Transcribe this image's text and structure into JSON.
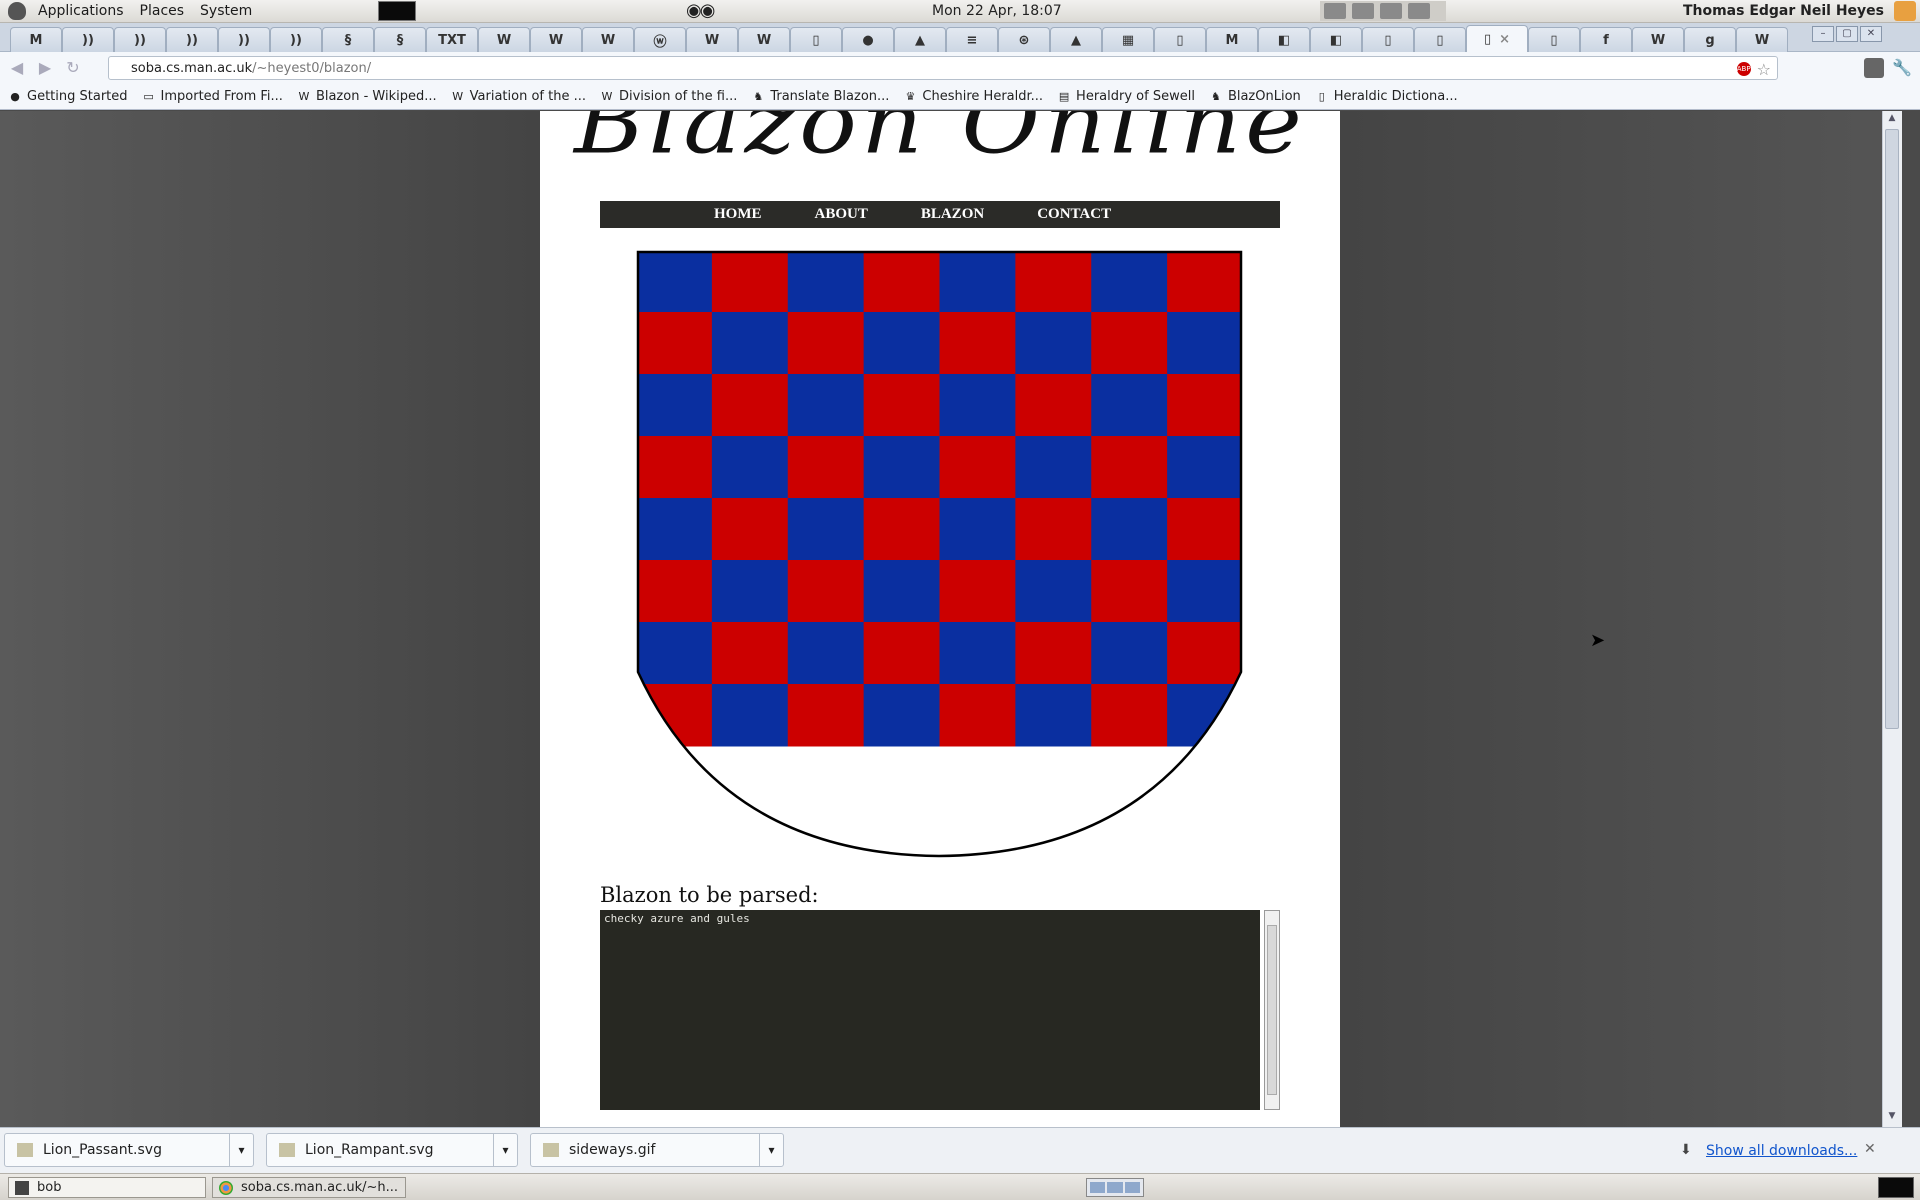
{
  "panel": {
    "menus": [
      "Applications",
      "Places",
      "System"
    ],
    "clock": "Mon 22 Apr, 18:07",
    "user": "Thomas Edgar Neil Heyes"
  },
  "tabs": [
    {
      "icon": "gmail-icon",
      "glyph": "M"
    },
    {
      "icon": "blazon-favicon",
      "glyph": "))"
    },
    {
      "icon": "blazon-favicon",
      "glyph": "))"
    },
    {
      "icon": "blazon-favicon",
      "glyph": "))"
    },
    {
      "icon": "blazon-favicon",
      "glyph": "))"
    },
    {
      "icon": "blazon-favicon",
      "glyph": "))"
    },
    {
      "icon": "heraldry-favicon",
      "glyph": "§"
    },
    {
      "icon": "heraldry-favicon",
      "glyph": "§"
    },
    {
      "icon": "document-icon",
      "glyph": "TXT"
    },
    {
      "icon": "wikipedia-icon",
      "glyph": "W"
    },
    {
      "icon": "wikipedia-icon",
      "glyph": "W"
    },
    {
      "icon": "wikipedia-icon",
      "glyph": "W"
    },
    {
      "icon": "wordpress-icon",
      "glyph": "ⓦ"
    },
    {
      "icon": "wikipedia-icon",
      "glyph": "W"
    },
    {
      "icon": "wikipedia-icon",
      "glyph": "W"
    },
    {
      "icon": "blank-page-icon",
      "glyph": "▯"
    },
    {
      "icon": "github-icon",
      "glyph": "●"
    },
    {
      "icon": "google-drive-icon",
      "glyph": "▲"
    },
    {
      "icon": "google-docs-icon",
      "glyph": "≡"
    },
    {
      "icon": "settings-icon",
      "glyph": "⊛"
    },
    {
      "icon": "google-drive-icon",
      "glyph": "▲"
    },
    {
      "icon": "google-sheets-icon",
      "glyph": "▦"
    },
    {
      "icon": "blank-page-icon",
      "glyph": "▯"
    },
    {
      "icon": "m-icon",
      "glyph": "M"
    },
    {
      "icon": "shield-icon",
      "glyph": "◧"
    },
    {
      "icon": "shield-icon",
      "glyph": "◧"
    },
    {
      "icon": "blank-page-icon",
      "glyph": "▯"
    },
    {
      "icon": "blank-page-icon",
      "glyph": "▯"
    },
    {
      "icon": "blank-page-icon",
      "glyph": "▯",
      "active": true
    },
    {
      "icon": "blank-page-icon",
      "glyph": "▯"
    },
    {
      "icon": "facebook-icon",
      "glyph": "f"
    },
    {
      "icon": "wikipedia-icon",
      "glyph": "W"
    },
    {
      "icon": "google-icon",
      "glyph": "g"
    },
    {
      "icon": "wikipedia-icon",
      "glyph": "W"
    }
  ],
  "toolbar": {
    "url_host": "soba.cs.man.ac.uk",
    "url_path": "/~heyest0/blazon/"
  },
  "bookmarks": [
    {
      "label": "Getting Started",
      "icon": "firefox-icon"
    },
    {
      "label": "Imported From Fi...",
      "icon": "folder-icon"
    },
    {
      "label": "Blazon - Wikiped...",
      "icon": "wikipedia-icon"
    },
    {
      "label": "Variation of the ...",
      "icon": "wikipedia-icon"
    },
    {
      "label": "Division of the fi...",
      "icon": "wikipedia-icon"
    },
    {
      "label": "Translate Blazon...",
      "icon": "lion-icon"
    },
    {
      "label": "Cheshire Heraldr...",
      "icon": "crown-icon"
    },
    {
      "label": "Heraldry of Sewell",
      "icon": "book-icon"
    },
    {
      "label": "BlazOnLion",
      "icon": "lion-icon"
    },
    {
      "label": "Heraldic Dictiona...",
      "icon": "page-icon"
    }
  ],
  "site": {
    "title": "Blazon Online",
    "nav": [
      "HOME",
      "ABOUT",
      "BLAZON",
      "CONTACT"
    ],
    "shield": {
      "tinctures": [
        "azure",
        "gules"
      ],
      "colors": {
        "azure": "#0a2fa0",
        "gules": "#cc0000"
      },
      "rows": 8,
      "cols": 8
    },
    "parse_label": "Blazon to be parsed:",
    "parse_text": "checky azure and gules"
  },
  "downloads": {
    "items": [
      "Lion_Passant.svg",
      "Lion_Rampant.svg",
      "sideways.gif"
    ],
    "show_all": "Show all downloads..."
  },
  "taskbar": {
    "items": [
      "bob",
      "soba.cs.man.ac.uk/~h..."
    ]
  }
}
